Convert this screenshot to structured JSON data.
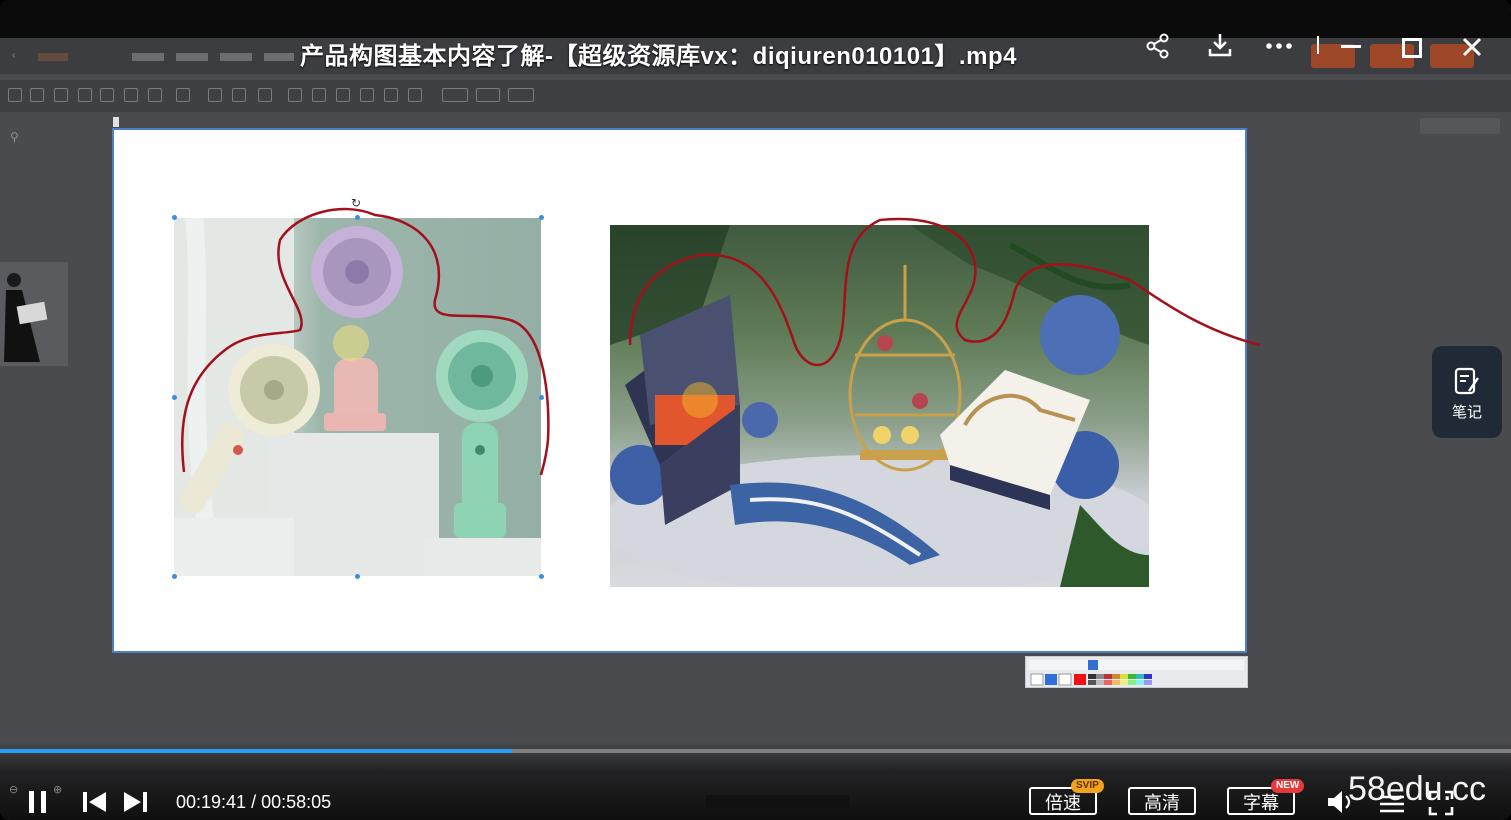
{
  "player": {
    "title": "产品构图基本内容了解-【超级资源库vx：diqiuren010101】.mp4",
    "current_time": "00:19:41",
    "separator": "/",
    "duration": "00:58:05",
    "progress": 0.339,
    "speed_label": "倍速",
    "speed_badge": "SVIP",
    "quality_label": "高清",
    "subtitle_label": "字幕",
    "subtitle_badge": "NEW",
    "note_label": "笔记",
    "watermark": "58edu.cc",
    "icons": [
      "share-icon",
      "download-icon",
      "more-icon",
      "minimize-icon",
      "maximize-icon",
      "close-icon",
      "pause-icon",
      "previous-icon",
      "next-icon",
      "volume-icon",
      "fullscreen-icon",
      "note-icon"
    ]
  },
  "colors": {
    "accent": "#2a9df4",
    "selection": "#3b8fdc",
    "annotation": "#a3101c",
    "note_bg": "#1f2a36",
    "svip": "#f2a31b",
    "new": "#e8393a"
  }
}
